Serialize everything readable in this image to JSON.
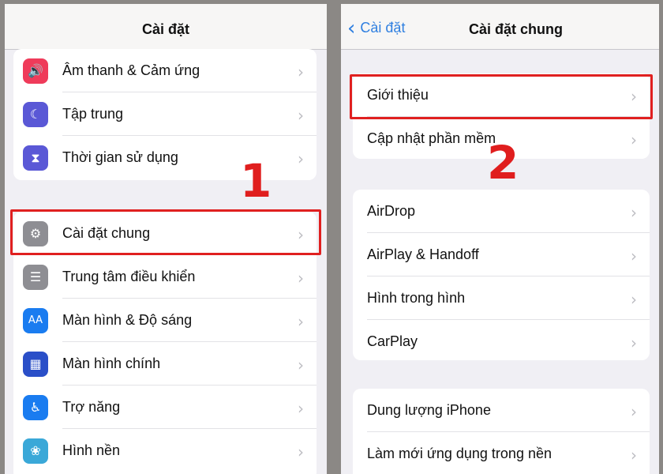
{
  "left": {
    "title": "Cài đặt",
    "step": "1",
    "group1": [
      {
        "label": "Âm thanh & Cảm ứng",
        "icon": "speaker-icon",
        "color": "#ef3b5a",
        "glyph": "🔊"
      },
      {
        "label": "Tập trung",
        "icon": "moon-icon",
        "color": "#5a58d6",
        "glyph": "☾"
      },
      {
        "label": "Thời gian sử dụng",
        "icon": "hourglass-icon",
        "color": "#5a58d6",
        "glyph": "⧗"
      }
    ],
    "group2": [
      {
        "label": "Cài đặt chung",
        "icon": "gear-icon",
        "color": "#8e8e93",
        "glyph": "⚙"
      },
      {
        "label": "Trung tâm điều khiển",
        "icon": "toggles-icon",
        "color": "#8e8e93",
        "glyph": "☰"
      },
      {
        "label": "Màn hình & Độ sáng",
        "icon": "text-size-icon",
        "color": "#1a7cf0",
        "glyph": "AA"
      },
      {
        "label": "Màn hình chính",
        "icon": "home-screen-icon",
        "color": "#2a4fc8",
        "glyph": "▦"
      },
      {
        "label": "Trợ năng",
        "icon": "accessibility-icon",
        "color": "#1a7cf0",
        "glyph": "♿"
      },
      {
        "label": "Hình nền",
        "icon": "wallpaper-icon",
        "color": "#3aa8d8",
        "glyph": "❀"
      }
    ]
  },
  "right": {
    "title": "Cài đặt chung",
    "back": "Cài đặt",
    "step": "2",
    "group1": [
      "Giới thiệu",
      "Cập nhật phần mềm"
    ],
    "group2": [
      "AirDrop",
      "AirPlay & Handoff",
      "Hình trong hình",
      "CarPlay"
    ],
    "group3": [
      "Dung lượng iPhone",
      "Làm mới ứng dụng trong nền"
    ]
  },
  "highlight_color": "#e02020"
}
